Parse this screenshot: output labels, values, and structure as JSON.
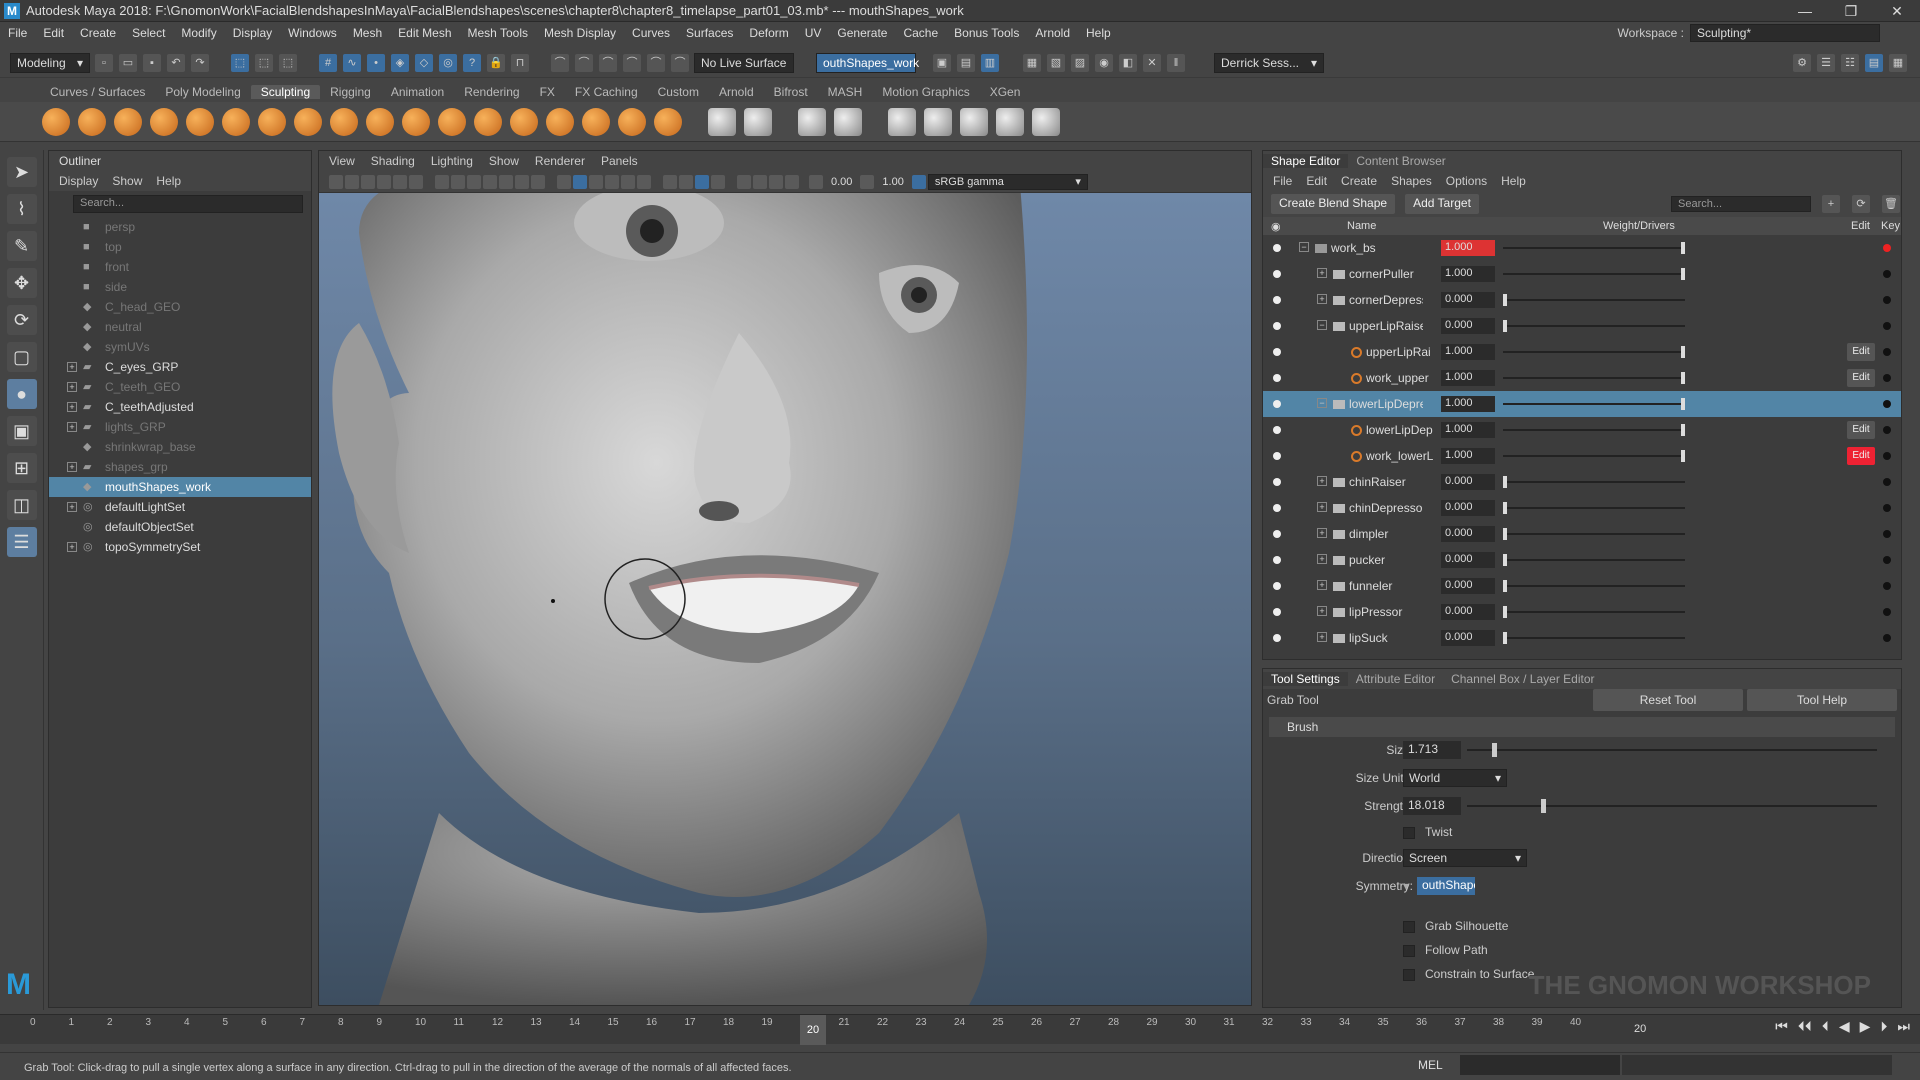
{
  "titlebar": {
    "title": "Autodesk Maya 2018: F:\\GnomonWork\\FacialBlendshapesInMaya\\FacialBlendshapes\\scenes\\chapter8\\chapter8_timelapse_part01_03.mb*  ---  mouthShapes_work",
    "minimize": "—",
    "restore": "❐",
    "close": "✕"
  },
  "menubar": [
    "File",
    "Edit",
    "Create",
    "Select",
    "Modify",
    "Display",
    "Windows",
    "Mesh",
    "Edit Mesh",
    "Mesh Tools",
    "Mesh Display",
    "Curves",
    "Surfaces",
    "Deform",
    "UV",
    "Generate",
    "Cache",
    "Bonus Tools",
    "Arnold",
    "Help"
  ],
  "workspace": {
    "label": "Workspace :",
    "value": "Sculpting*"
  },
  "statusline": {
    "mode": "Modeling",
    "live_surface": "No Live Surface",
    "object_field": "outhShapes_work",
    "user": "Derrick Sess..."
  },
  "shelf_tabs": [
    "Curves / Surfaces",
    "Poly Modeling",
    "Sculpting",
    "Rigging",
    "Animation",
    "Rendering",
    "FX",
    "FX Caching",
    "Custom",
    "Arnold",
    "Bifrost",
    "MASH",
    "Motion Graphics",
    "XGen"
  ],
  "outliner": {
    "tab": "Outliner",
    "menu": [
      "Display",
      "Show",
      "Help"
    ],
    "search_placeholder": "Search...",
    "items": [
      {
        "label": "persp",
        "dim": true,
        "icon": "camera-icon"
      },
      {
        "label": "top",
        "dim": true,
        "icon": "camera-icon"
      },
      {
        "label": "front",
        "dim": true,
        "icon": "camera-icon"
      },
      {
        "label": "side",
        "dim": true,
        "icon": "camera-icon"
      },
      {
        "label": "C_head_GEO",
        "dim": true,
        "icon": "mesh-icon"
      },
      {
        "label": "neutral",
        "dim": true,
        "icon": "mesh-icon"
      },
      {
        "label": "symUVs",
        "dim": true,
        "icon": "mesh-icon"
      },
      {
        "label": "C_eyes_GRP",
        "dim": false,
        "icon": "group-icon",
        "expand": true
      },
      {
        "label": "C_teeth_GEO",
        "dim": true,
        "icon": "group-icon",
        "expand": true
      },
      {
        "label": "C_teethAdjusted",
        "dim": false,
        "icon": "group-icon",
        "expand": true
      },
      {
        "label": "lights_GRP",
        "dim": true,
        "icon": "group-icon",
        "expand": true
      },
      {
        "label": "shrinkwrap_base",
        "dim": true,
        "icon": "mesh-icon"
      },
      {
        "label": "shapes_grp",
        "dim": true,
        "icon": "group-icon",
        "expand": true
      },
      {
        "label": "mouthShapes_work",
        "dim": false,
        "icon": "mesh-icon",
        "selected": true
      },
      {
        "label": "defaultLightSet",
        "dim": false,
        "icon": "set-icon",
        "expand": true
      },
      {
        "label": "defaultObjectSet",
        "dim": false,
        "icon": "set-icon"
      },
      {
        "label": "topoSymmetrySet",
        "dim": false,
        "icon": "set-icon",
        "expand": true
      }
    ]
  },
  "viewport": {
    "menu": [
      "View",
      "Shading",
      "Lighting",
      "Show",
      "Renderer",
      "Panels"
    ],
    "exposure": "0.00",
    "gamma": "1.00",
    "colorspace": "sRGB gamma"
  },
  "shape_editor": {
    "tabs": [
      "Shape Editor",
      "Content Browser"
    ],
    "menu": [
      "File",
      "Edit",
      "Create",
      "Shapes",
      "Options",
      "Help"
    ],
    "create_blend_shape": "Create Blend Shape",
    "add_target": "Add Target",
    "search_placeholder": "Search...",
    "headers": {
      "name": "Name",
      "weight": "Weight/Drivers",
      "edit": "Edit",
      "key": "Key"
    },
    "rows": [
      {
        "name": "work_bs",
        "weight": "1.000",
        "kind": "node",
        "indent": 0,
        "red": true,
        "slider": 1.0,
        "keyred": true
      },
      {
        "name": "cornerPuller",
        "weight": "1.000",
        "kind": "folder",
        "indent": 1,
        "slider": 1.0
      },
      {
        "name": "cornerDepressor",
        "weight": "0.000",
        "kind": "folder",
        "indent": 1,
        "slider": 0.0
      },
      {
        "name": "upperLipRaiser",
        "weight": "0.000",
        "kind": "folder",
        "indent": 1,
        "slider": 0.0
      },
      {
        "name": "upperLipRai",
        "weight": "1.000",
        "kind": "target",
        "indent": 2,
        "slider": 1.0,
        "edit": "Edit"
      },
      {
        "name": "work_upper",
        "weight": "1.000",
        "kind": "target",
        "indent": 2,
        "slider": 1.0,
        "edit": "Edit"
      },
      {
        "name": "lowerLipDepressor",
        "weight": "1.000",
        "kind": "folder",
        "indent": 1,
        "slider": 1.0,
        "selected": true
      },
      {
        "name": "lowerLipDep",
        "weight": "1.000",
        "kind": "target",
        "indent": 2,
        "slider": 1.0,
        "edit": "Edit"
      },
      {
        "name": "work_lowerL",
        "weight": "1.000",
        "kind": "target",
        "indent": 2,
        "slider": 1.0,
        "edit": "Edit",
        "editred": true
      },
      {
        "name": "chinRaiser",
        "weight": "0.000",
        "kind": "folder",
        "indent": 1,
        "slider": 0.0
      },
      {
        "name": "chinDepressor",
        "weight": "0.000",
        "kind": "folder",
        "indent": 1,
        "slider": 0.0
      },
      {
        "name": "dimpler",
        "weight": "0.000",
        "kind": "folder",
        "indent": 1,
        "slider": 0.0
      },
      {
        "name": "pucker",
        "weight": "0.000",
        "kind": "folder",
        "indent": 1,
        "slider": 0.0
      },
      {
        "name": "funneler",
        "weight": "0.000",
        "kind": "folder",
        "indent": 1,
        "slider": 0.0
      },
      {
        "name": "lipPressor",
        "weight": "0.000",
        "kind": "folder",
        "indent": 1,
        "slider": 0.0
      },
      {
        "name": "lipSuck",
        "weight": "0.000",
        "kind": "folder",
        "indent": 1,
        "slider": 0.0
      }
    ]
  },
  "tool_settings": {
    "tabs": [
      "Tool Settings",
      "Attribute Editor",
      "Channel Box / Layer Editor"
    ],
    "tool": "Grab Tool",
    "reset": "Reset Tool",
    "help": "Tool Help",
    "section": "Brush",
    "size_label": "Size:",
    "size": "1.713",
    "size_level": 0.06,
    "units_label": "Size Units:",
    "units": "World",
    "strength_label": "Strength:",
    "strength": "18.018",
    "strength_level": 0.18,
    "twist": "Twist",
    "direction_label": "Direction:",
    "direction": "Screen",
    "symmetry_label": "Symmetry:",
    "symmetry": "outhShape",
    "grab_silhouette": "Grab Silhouette",
    "follow_path": "Follow Path",
    "constrain": "Constrain to Surface"
  },
  "timeline": {
    "ticks": [
      "0",
      "1",
      "2",
      "3",
      "4",
      "5",
      "6",
      "7",
      "8",
      "9",
      "10",
      "11",
      "12",
      "13",
      "14",
      "15",
      "16",
      "17",
      "18",
      "19",
      "20",
      "21",
      "22",
      "23",
      "24",
      "25",
      "26",
      "27",
      "28",
      "29",
      "30",
      "31",
      "32",
      "33",
      "34",
      "35",
      "36",
      "37",
      "38",
      "39",
      "40"
    ],
    "current": "20",
    "end": "20"
  },
  "helpline": "Grab Tool: Click-drag to pull a single vertex along a surface in any direction. Ctrl-drag to pull in the direction of the average of the normals of all affected faces.",
  "mel": "MEL",
  "watermark": "THE GNOMON WORKSHOP",
  "colors": {
    "selection": "#5285a6",
    "accent_red": "#dd3333",
    "viewport_bg": "#6f88a8"
  }
}
